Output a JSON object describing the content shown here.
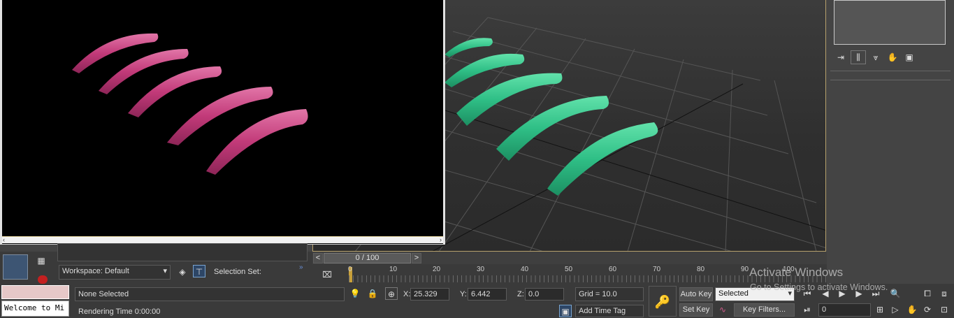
{
  "viewport": {
    "progress_label": "0 / 100",
    "prev_frame_label": "<",
    "next_frame_label": ">"
  },
  "timeline": {
    "ticks": [
      "0",
      "10",
      "20",
      "30",
      "40",
      "50",
      "60",
      "70",
      "80",
      "90",
      "100"
    ]
  },
  "workspace": {
    "label": "Workspace: Default",
    "selection_set_label": "Selection Set:"
  },
  "status": {
    "maxscript_text": "Welcome to Mi",
    "selection_text": "None Selected",
    "rendering_time": "Rendering Time  0:00:00",
    "x_label": "X:",
    "x_value": "25.329",
    "y_label": "Y:",
    "y_value": "6.442",
    "z_label": "Z:",
    "z_value": "0.0",
    "grid_text": "Grid = 10.0",
    "add_time_tag": "Add Time Tag"
  },
  "animation": {
    "auto_key": "Auto Key",
    "set_key": "Set Key",
    "key_mode": "Selected",
    "key_filters": "Key Filters...",
    "current_frame": "0"
  },
  "watermark": {
    "title": "Activate Windows",
    "subtitle": "Go to Settings to activate Windows."
  },
  "colors": {
    "render_object": "#c23a79",
    "viewport_object": "#2fbf86",
    "viewport_border": "#b7a16c"
  }
}
